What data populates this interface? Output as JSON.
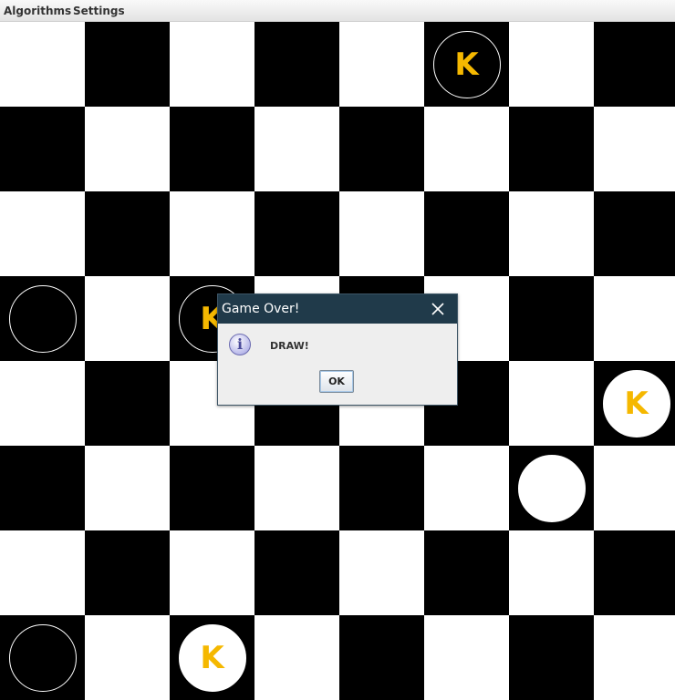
{
  "menu": {
    "items": [
      {
        "label": "Algorithms"
      },
      {
        "label": "Settings"
      }
    ]
  },
  "board": {
    "size": 8,
    "light_square_color": "#ffffff",
    "dark_square_color": "#000000",
    "king_color": "#f5b800",
    "pieces": [
      {
        "row": 0,
        "col": 5,
        "color": "black",
        "king": true,
        "label": "K"
      },
      {
        "row": 3,
        "col": 0,
        "color": "black",
        "king": false,
        "label": ""
      },
      {
        "row": 3,
        "col": 2,
        "color": "black",
        "king": true,
        "label": "K"
      },
      {
        "row": 4,
        "col": 7,
        "color": "white",
        "king": true,
        "label": "K"
      },
      {
        "row": 5,
        "col": 6,
        "color": "white",
        "king": false,
        "label": ""
      },
      {
        "row": 7,
        "col": 0,
        "color": "black",
        "king": false,
        "label": ""
      },
      {
        "row": 7,
        "col": 2,
        "color": "white",
        "king": true,
        "label": "K"
      }
    ]
  },
  "dialog": {
    "title": "Game Over!",
    "message": "DRAW!",
    "icon": "info-icon",
    "ok_label": "OK",
    "close_icon": "close-icon"
  }
}
